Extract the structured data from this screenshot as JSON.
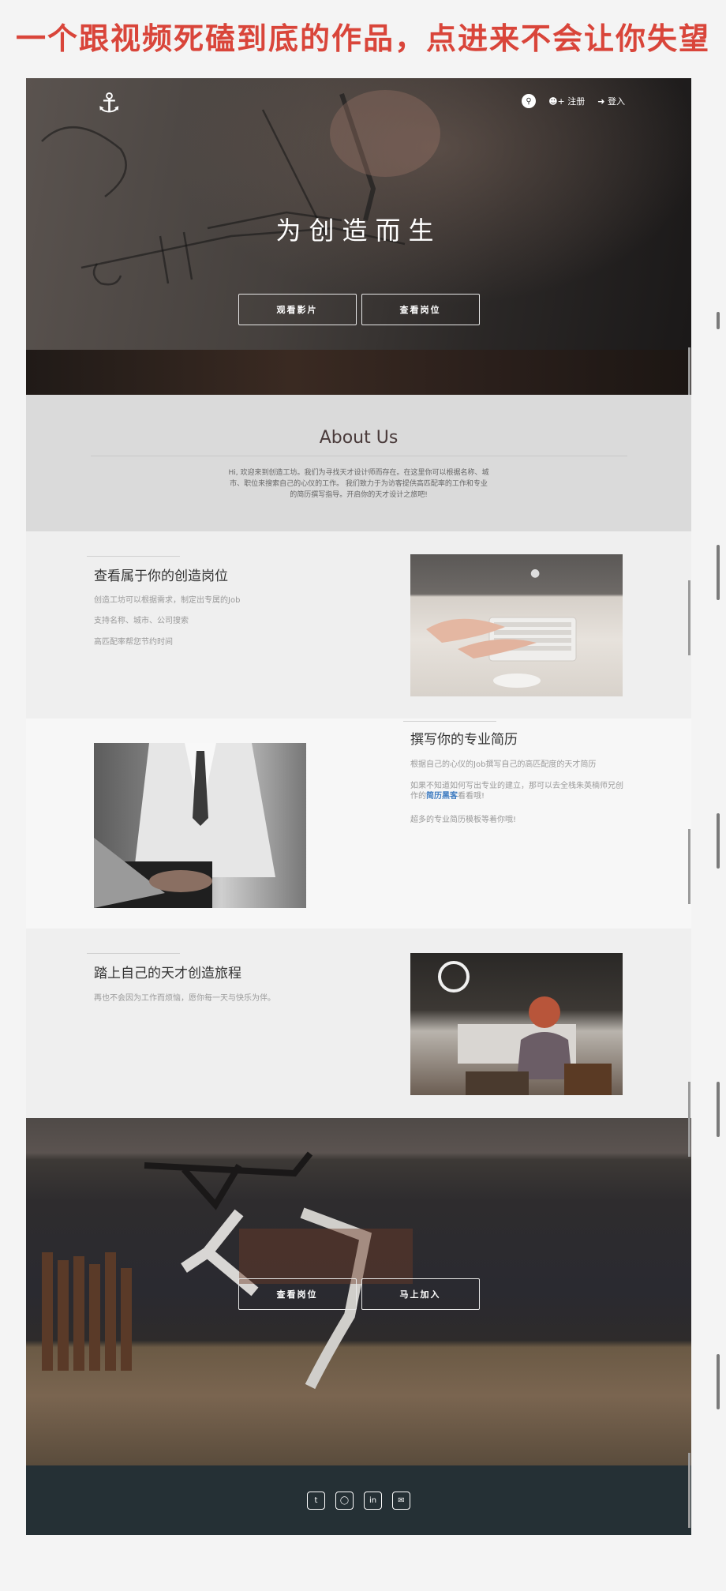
{
  "banner": {
    "text": "一个跟视频死磕到底的作品，点进来不会让你失望"
  },
  "header": {
    "logo_icon": "anchor-icon",
    "search_icon": "search-icon",
    "register_label": "注册",
    "login_label": "登入"
  },
  "hero": {
    "title": "为创造而生",
    "watch_film_label": "观看影片",
    "view_jobs_label": "查看岗位"
  },
  "about": {
    "title": "About Us",
    "text": "Hi, 欢迎来到创造工坊。我们为寻找天才设计师而存在。在这里你可以根据名称、城市、职位来搜索自己的心仪的工作。 我们致力于为访客提供高匹配率的工作和专业的简历撰写指导。开启你的天才设计之旅吧!"
  },
  "features": [
    {
      "title": "查看属于你的创造岗位",
      "lines": [
        "创造工坊可以根据需求，制定出专属的Job",
        "支持名称、城市、公司搜索",
        "高匹配率帮您节约时间"
      ]
    },
    {
      "title": "撰写你的专业简历",
      "line1": "根据自己的心仪的Job撰写自己的高匹配度的天才简历",
      "line2_before": "如果不知道如何写出专业的建立，那可以去全栈朱英楠师兄创作的",
      "line2_link": "简历黑客",
      "line2_after": "看看哦!",
      "line3": "超多的专业简历模板等着你哦!"
    },
    {
      "title": "踏上自己的天才创造旅程",
      "lines": [
        "再也不会因为工作而烦恼，愿你每一天与快乐为伴。"
      ]
    }
  ],
  "cta": {
    "view_jobs_label": "查看岗位",
    "join_label": "马上加入"
  },
  "footer": {
    "icons": [
      "twitter-icon",
      "github-icon",
      "linkedin-icon",
      "envelope-icon"
    ],
    "glyphs": [
      "t",
      "◯",
      "in",
      "✉"
    ]
  },
  "colors": {
    "banner_red": "#d9453a",
    "footer_bg": "#253035",
    "link_blue": "#3f7cc1"
  }
}
